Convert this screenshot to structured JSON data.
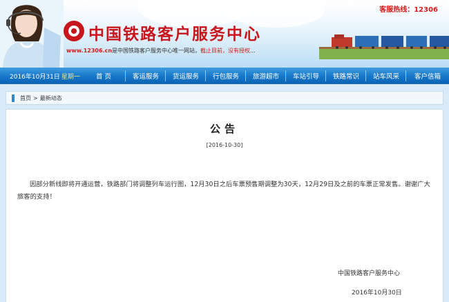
{
  "header": {
    "hotline": "客服热线：12306",
    "site_title": "中国铁路客户服务中心",
    "tagline_url": "www.12306.cn",
    "tagline_text": "是中国铁路客户服务中心唯一网站，",
    "tagline_warn": "截止目前，没有授权",
    "tagline_end": "..."
  },
  "nav": {
    "date": "2016年10月31日",
    "weekday": "星期一",
    "items": [
      "首 页",
      "客运服务",
      "货运服务",
      "行包服务",
      "旅游超市",
      "车站引导",
      "铁路常识",
      "站车风采",
      "客户信箱"
    ]
  },
  "breadcrumb": {
    "home": "首页",
    "separator": ">",
    "current": "最新动态"
  },
  "notice": {
    "title": "公告",
    "date": "[2016-10-30]",
    "body": "因部分新线即将开通运营，铁路部门将调整列车运行图，12月30日之后车票预售期调整为30天，12月29日及之前的车票正常发售。谢谢广大旅客的支持！",
    "sign_org": "中国铁路客户服务中心",
    "sign_date": "2016年10月30日"
  },
  "colors": {
    "brand_red": "#c8161d",
    "nav_blue": "#1576c9",
    "page_bg": "#d9ebf8"
  }
}
